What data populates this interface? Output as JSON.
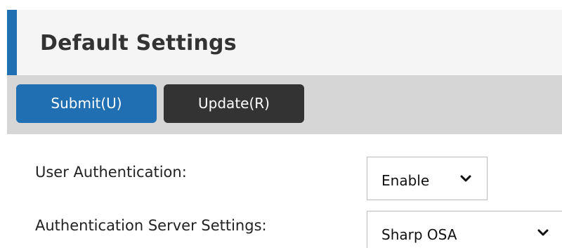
{
  "header": {
    "title": "Default Settings"
  },
  "toolbar": {
    "submit_label": "Submit(U)",
    "update_label": "Update(R)"
  },
  "form": {
    "user_authentication": {
      "label": "User Authentication:",
      "value": "Enable"
    },
    "authentication_server": {
      "label": "Authentication Server Settings:",
      "value": "Sharp OSA"
    }
  },
  "colors": {
    "accent": "#1f6fb2",
    "dark_button": "#333333",
    "toolbar_bg": "#d6d6d6"
  },
  "icons": {
    "dropdown": "chevron-down-icon"
  }
}
